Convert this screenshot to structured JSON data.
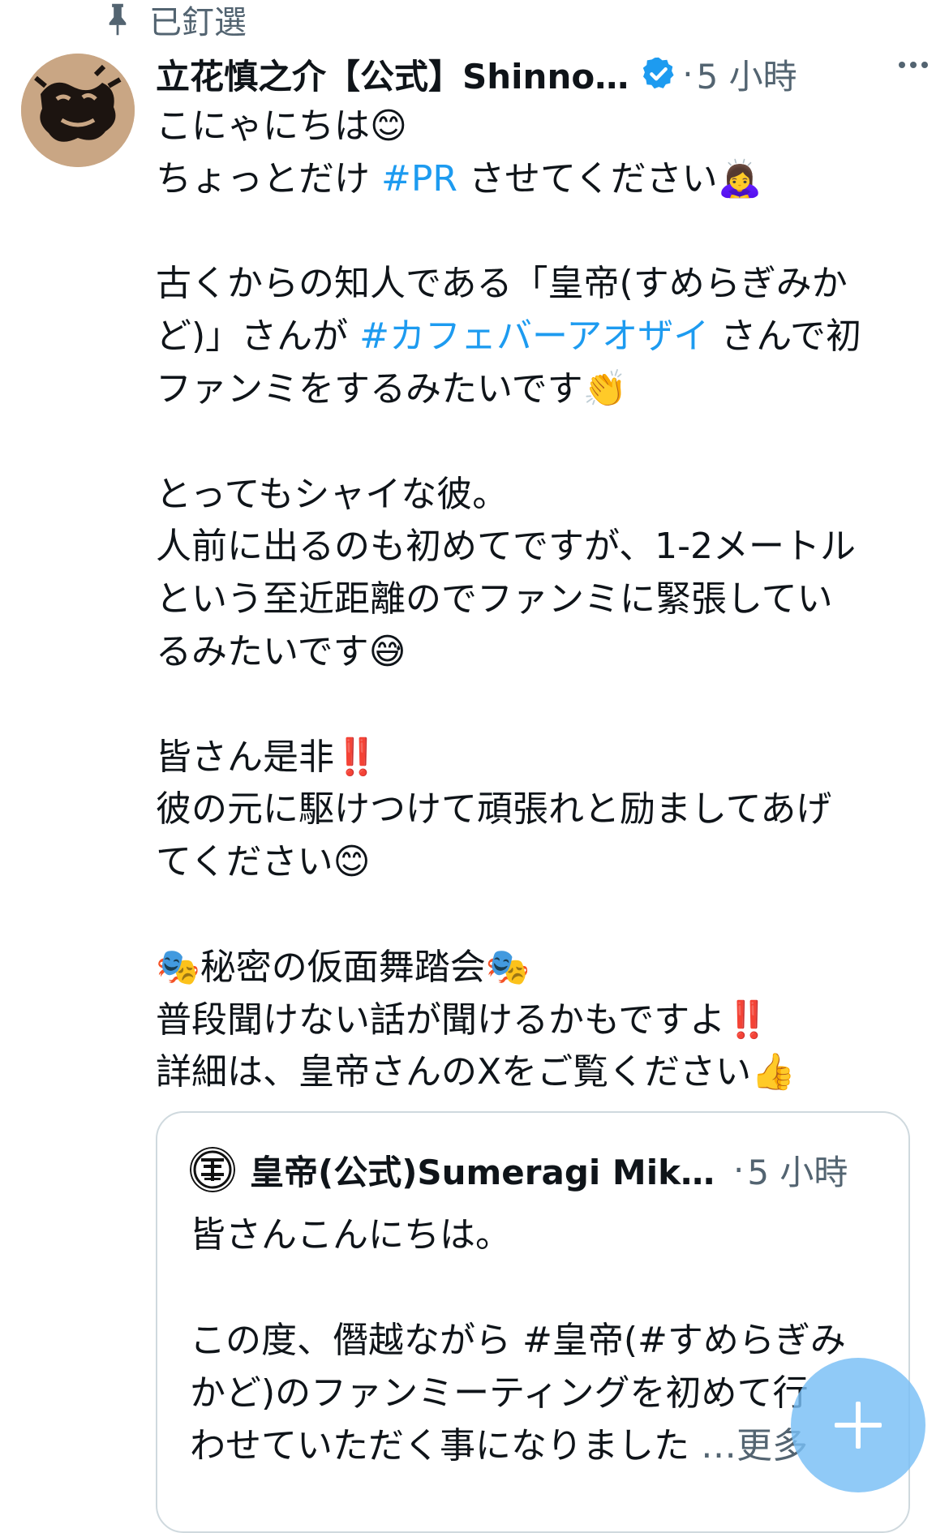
{
  "pinned": {
    "label": "已釘選",
    "icon": "pin-icon"
  },
  "tweet": {
    "author_name": "立花慎之介【公式】Shinno…",
    "verified_icon": "verified-badge-icon",
    "separator": "·",
    "time": "5 小時",
    "more_icon": "more-options-icon",
    "lines": {
      "l1": "こにゃにちは😊",
      "l2a": "ちょっとだけ ",
      "l2_hashtag": "#PR",
      "l2b": " させてください🙇‍♀️",
      "l3": "",
      "l4": "古くからの知人である「皇帝(すめらぎみか",
      "l5a": "ど)」さんが ",
      "l5_hashtag": "#カフェバーアオザイ",
      "l5b": " さんで初",
      "l6": "ファンミをするみたいです👏",
      "l7": "",
      "l8": "とってもシャイな彼。",
      "l9": "人前に出るのも初めてですが、1-2メートル",
      "l10": "という至近距離のでファンミに緊張してい",
      "l11": "るみたいです😅",
      "l12": "",
      "l13": "皆さん是非‼️",
      "l14": "彼の元に駆けつけて頑張れと励ましてあげ",
      "l15": "てください😊",
      "l16": "",
      "l17": "🎭秘密の仮面舞踏会🎭",
      "l18": "普段聞けない話が聞けるかもですよ‼️",
      "l19": "詳細は、皇帝さんのXをご覧ください👍"
    }
  },
  "quote": {
    "author_name": "皇帝(公式)Sumeragi Mika…",
    "separator": "·",
    "time": "5 小時",
    "lines": {
      "q1": "皆さんこんにちは。",
      "q2": "",
      "q3": "この度、僭越ながら #皇帝(#すめらぎみ",
      "q4": "かど)のファンミーティングを初めて行",
      "q5": "わせていただく事になりました",
      "show_more": " …更多"
    }
  },
  "fab": {
    "icon": "compose-plus-icon"
  },
  "colors": {
    "link": "#1d9bf0",
    "secondary": "#536471",
    "border": "#cfd9de",
    "fab": "#78bef5"
  }
}
